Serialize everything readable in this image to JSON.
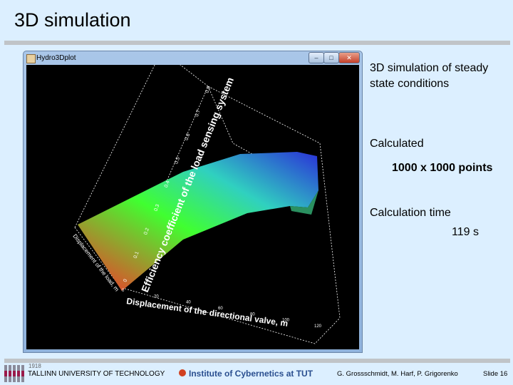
{
  "slide": {
    "title": "3D simulation",
    "number_label": "Slide 16"
  },
  "window": {
    "title": "Hydro3Dplot",
    "buttons": {
      "minimize": "–",
      "maximize": "□",
      "close": "✕"
    }
  },
  "plot": {
    "z_axis_label": "Efficiency coefficient of the load sensing system",
    "x_axis_label": "Displacement of the directional valve, m",
    "y_axis_label": "Displacement of the load, m",
    "z_ticks": [
      "0",
      "0.1",
      "0.2",
      "0.3",
      "0.4",
      "0.5",
      "0.6",
      "0.7",
      "0.8"
    ],
    "x_ticks": [
      "0",
      "20",
      "40",
      "60",
      "80",
      "100",
      "120"
    ],
    "colors": {
      "low": "#ff3030",
      "mid": "#30ff30",
      "high": "#3030e0"
    }
  },
  "side_text": {
    "desc": "3D simulation of steady state conditions",
    "calc_label": "Calculated",
    "points": "1000 x 1000 points",
    "time_label": "Calculation time",
    "time_value": "119 s"
  },
  "footer": {
    "year": "1918",
    "university": "TALLINN UNIVERSITY OF TECHNOLOGY",
    "institute": "Institute of Cybernetics at TUT",
    "authors": "G. Grossschmidt, M. Harf, P. Grigorenko"
  }
}
